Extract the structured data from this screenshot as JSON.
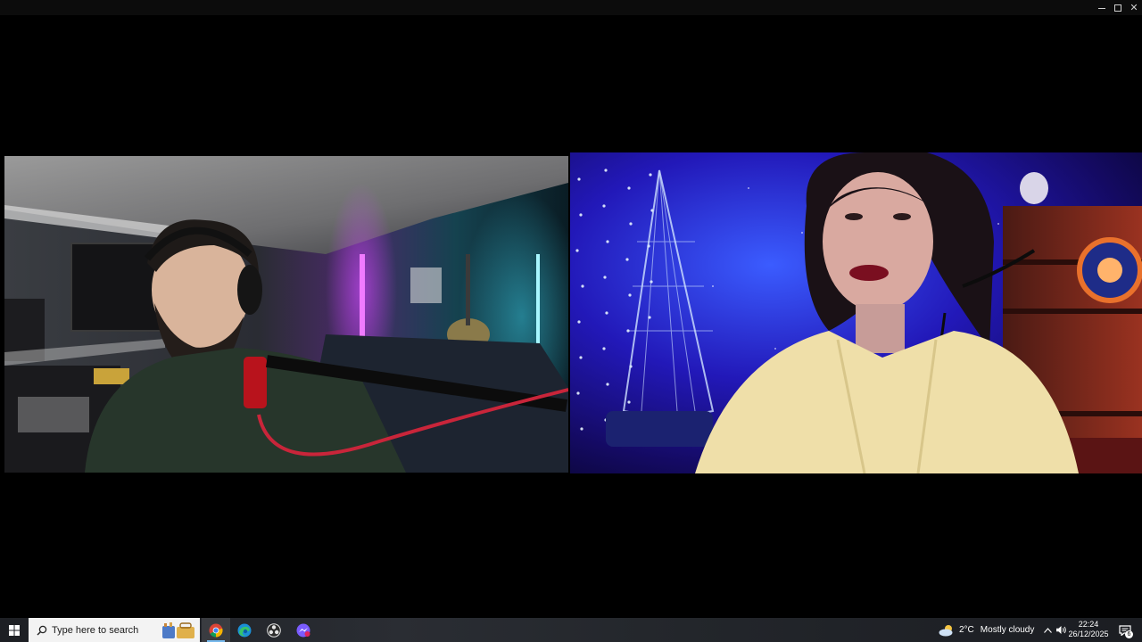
{
  "window": {
    "controls": {
      "minimize_icon": "minimize-icon",
      "maximize_icon": "maximize-icon",
      "close_icon": "close-icon",
      "close_glyph": "✕"
    }
  },
  "video_tiles": [
    {
      "id": "participant-left",
      "scene": "man with headphones and microphone boom arm in room lit by purple and cyan LED"
    },
    {
      "id": "participant-right",
      "scene": "woman with headset in front of blue starry backdrop with fairy lights"
    }
  ],
  "taskbar": {
    "start_icon": "windows-start-icon",
    "search": {
      "placeholder": "Type here to search",
      "icon": "search-icon"
    },
    "apps": [
      {
        "name": "chrome",
        "icon": "chrome-icon",
        "active": true
      },
      {
        "name": "edge",
        "icon": "edge-icon",
        "active": false
      },
      {
        "name": "obs",
        "icon": "obs-icon",
        "active": false
      },
      {
        "name": "messenger",
        "icon": "messenger-icon",
        "active": false
      }
    ],
    "weather": {
      "icon": "partly-cloudy-icon",
      "temperature": "2°C",
      "description": "Mostly cloudy"
    },
    "tray": {
      "chevron_glyph": "^",
      "volume_icon": "volume-icon"
    },
    "clock": {
      "time": "22:24",
      "date": "26/12/2025"
    },
    "notifications": {
      "icon": "notification-icon",
      "count": "6"
    }
  },
  "colors": {
    "taskbar_bg": "#23262b",
    "search_bg": "#f3f3f3",
    "accent": "#76b9ed",
    "titlebar_bg": "#0c0c0c"
  }
}
